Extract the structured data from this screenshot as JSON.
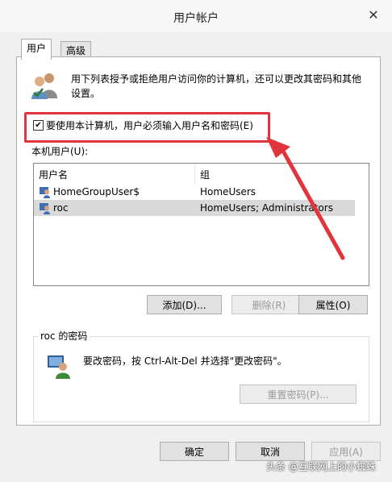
{
  "window": {
    "title": "用户帐户",
    "close_icon": "close-icon"
  },
  "tabs": [
    {
      "label": "用户"
    },
    {
      "label": "高级"
    }
  ],
  "intro": {
    "text": "用下列表授予或拒绝用户访问你的计算机，还可以更改其密码和其他设置。"
  },
  "require_login": {
    "label": "要使用本计算机，用户必须输入用户名和密码(E)",
    "checked": true
  },
  "users_section": {
    "label": "本机用户(U):",
    "columns": [
      "用户名",
      "组"
    ],
    "rows": [
      {
        "name": "HomeGroupUser$",
        "group": "HomeUsers"
      },
      {
        "name": "roc",
        "group": "HomeUsers; Administrators"
      }
    ],
    "selected_row": 1
  },
  "user_buttons": {
    "add": "添加(D)...",
    "remove": "删除(R)",
    "properties": "属性(O)"
  },
  "password_section": {
    "title": "roc 的密码",
    "text": "要改密码，按 Ctrl-Alt-Del 并选择\"更改密码\"。",
    "reset_button": "重置密码(P)..."
  },
  "dialog_buttons": {
    "ok": "确定",
    "cancel": "取消",
    "apply": "应用(A)"
  },
  "watermark": "头条 @互联网上的小蜘蛛",
  "colors": {
    "highlight": "#e1343c",
    "selected_row": "#d9d9d9"
  }
}
